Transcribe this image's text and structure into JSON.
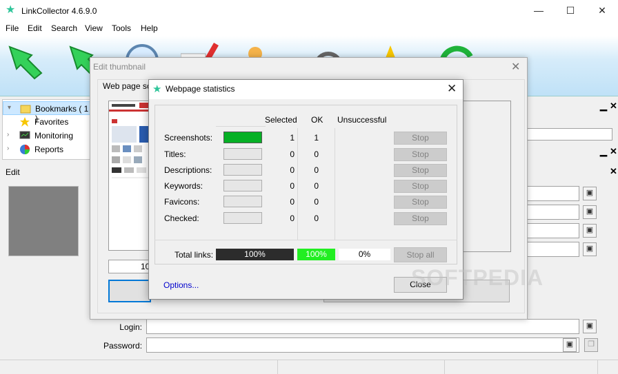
{
  "app": {
    "title": "LinkCollector 4.6.9.0"
  },
  "window_controls": {
    "minimize": "—",
    "maximize": "☐",
    "close": "✕"
  },
  "menu": [
    "File",
    "Edit",
    "Search",
    "View",
    "Tools",
    "Help"
  ],
  "tree": [
    {
      "label": "Bookmarks ( 1 )",
      "selected": true,
      "icon": "folder-icon",
      "color": "#f5d65b"
    },
    {
      "label": "Favorites",
      "selected": false,
      "icon": "star-icon",
      "color": "#f7c600"
    },
    {
      "label": "Monitoring",
      "selected": false,
      "icon": "monitor-icon",
      "color": "#555555"
    },
    {
      "label": "Reports",
      "selected": false,
      "icon": "pie-chart-icon",
      "color": "#e03030"
    }
  ],
  "edit_panel": {
    "header": "Edit"
  },
  "form": {
    "login_label": "Login:",
    "password_label": "Password:"
  },
  "edit_thumbnail": {
    "title": "Edit thumbnail",
    "group_label": "Web page sc",
    "size_value": "10"
  },
  "stats_dialog": {
    "title": "Webpage statistics",
    "columns": {
      "selected": "Selected",
      "ok": "OK",
      "unsuccessful": "Unsuccessful"
    },
    "rows": [
      {
        "label": "Screenshots:",
        "selected": "1",
        "ok": "1",
        "progress": 1.0,
        "stop": "Stop"
      },
      {
        "label": "Titles:",
        "selected": "0",
        "ok": "0",
        "progress": 0,
        "stop": "Stop"
      },
      {
        "label": "Descriptions:",
        "selected": "0",
        "ok": "0",
        "progress": 0,
        "stop": "Stop"
      },
      {
        "label": "Keywords:",
        "selected": "0",
        "ok": "0",
        "progress": 0,
        "stop": "Stop"
      },
      {
        "label": "Favicons:",
        "selected": "0",
        "ok": "0",
        "progress": 0,
        "stop": "Stop"
      },
      {
        "label": "Checked:",
        "selected": "0",
        "ok": "0",
        "progress": 0,
        "stop": "Stop"
      }
    ],
    "total": {
      "label": "Total links:",
      "selected_pct": "100%",
      "ok_pct": "100%",
      "unsuccessful_pct": "0%",
      "stop_all": "Stop all"
    },
    "options_link": "Options...",
    "close_button": "Close"
  },
  "watermark": "SOFTPEDIA",
  "colors": {
    "accent": "#0078d7",
    "progress_green": "#06b025",
    "ok_green": "#22ee22",
    "total_dark": "#333333",
    "link": "#0000cc"
  }
}
